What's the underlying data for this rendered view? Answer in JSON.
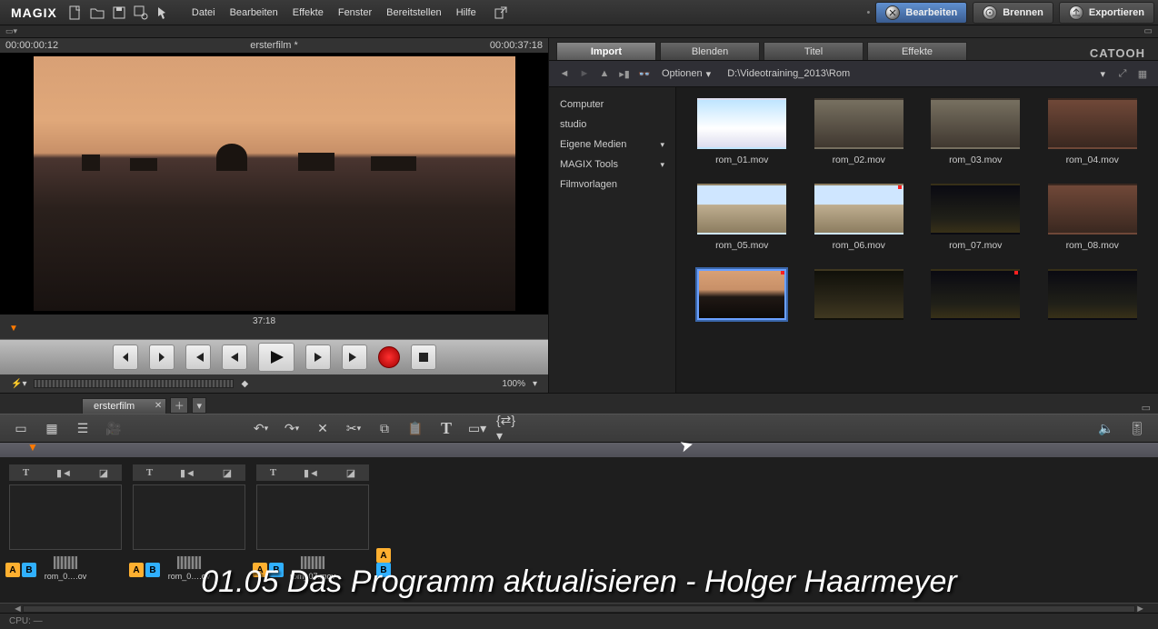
{
  "logo": "MAGIX",
  "menus": [
    "Datei",
    "Bearbeiten",
    "Effekte",
    "Fenster",
    "Bereitstellen",
    "Hilfe"
  ],
  "edit_button": "Bearbeiten",
  "burn_button": "Brennen",
  "export_button": "Exportieren",
  "preview": {
    "timecode_left": "00:00:00:12",
    "title": "ersterfilm *",
    "timecode_right": "00:00:37:18",
    "playhead_label": "37:18",
    "zoom_value": "100%"
  },
  "browser": {
    "tabs": [
      "Import",
      "Blenden",
      "Titel",
      "Effekte"
    ],
    "active_tab": 0,
    "brand": "CATOOH",
    "options_label": "Optionen",
    "path": "D:\\Videotraining_2013\\Rom",
    "places": [
      {
        "label": "Computer",
        "sub": false
      },
      {
        "label": "studio",
        "sub": false
      },
      {
        "label": "Eigene Medien",
        "sub": true
      },
      {
        "label": "MAGIX Tools",
        "sub": true
      },
      {
        "label": "Filmvorlagen",
        "sub": false
      }
    ],
    "clips": [
      {
        "label": "rom_01.mov",
        "cls": "th-sky",
        "red": false,
        "sel": false
      },
      {
        "label": "rom_02.mov",
        "cls": "th-ruin",
        "red": false,
        "sel": false
      },
      {
        "label": "rom_03.mov",
        "cls": "th-ruin",
        "red": false,
        "sel": false
      },
      {
        "label": "rom_04.mov",
        "cls": "th-people",
        "red": false,
        "sel": false
      },
      {
        "label": "rom_05.mov",
        "cls": "th-church",
        "red": false,
        "sel": false
      },
      {
        "label": "rom_06.mov",
        "cls": "th-church",
        "red": true,
        "sel": false
      },
      {
        "label": "rom_07.mov",
        "cls": "th-night",
        "red": false,
        "sel": false
      },
      {
        "label": "rom_08.mov",
        "cls": "th-people",
        "red": false,
        "sel": false
      },
      {
        "label": "",
        "cls": "th-sunset",
        "red": true,
        "sel": true
      },
      {
        "label": "",
        "cls": "th-plaza",
        "red": false,
        "sel": false
      },
      {
        "label": "",
        "cls": "th-night",
        "red": true,
        "sel": false
      },
      {
        "label": "",
        "cls": "th-night",
        "red": false,
        "sel": false
      }
    ]
  },
  "timeline": {
    "tab_label": "ersterfilm",
    "clips": [
      {
        "label": "rom_0….ov",
        "cls": "th-sunset"
      },
      {
        "label": "rom_0….ov",
        "cls": "th-ruin"
      },
      {
        "label": "rom_07.mov",
        "cls": "th-night"
      }
    ]
  },
  "overlay_caption": "01.05 Das Programm aktualisieren - Holger Haarmeyer",
  "status": {
    "cpu_label": "CPU: —"
  }
}
